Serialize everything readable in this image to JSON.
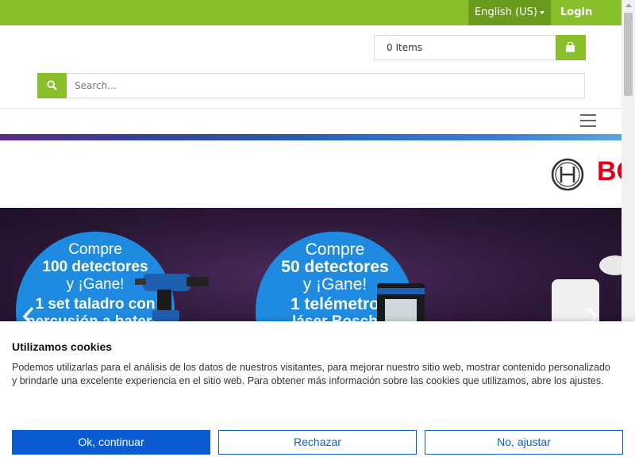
{
  "topbar": {
    "language": "English (US)",
    "login": "Login"
  },
  "cart": {
    "label": "0 Items"
  },
  "search": {
    "placeholder": "Search..."
  },
  "brand": {
    "name": "BOSCH"
  },
  "hero": {
    "promo1": {
      "line1": "Compre",
      "line2": "100 detectores",
      "line3": "y ¡Gane!",
      "line4": "1 set taladro con",
      "line5": "percusión a batería"
    },
    "promo2": {
      "line1": "Compre",
      "line2": "50 detectores",
      "line3": "y ¡Gane!",
      "line4": "1 telémetro",
      "line5": "láser Bosch"
    }
  },
  "cookie": {
    "title": "Utilizamos cookies",
    "text": "Podemos utilizarlas para el análisis de los datos de nuestros visitantes, para mejorar nuestro sitio web, mostrar contenido personalizado y brindarle una excelente experiencia en el sitio web. Para obtener más información sobre las cookies que utilizamos, abre los ajustes.",
    "ok": "Ok, continuar",
    "reject": "Rechazar",
    "adjust": "No, ajustar"
  },
  "colors": {
    "brand_green": "#8abf2c",
    "dark_green": "#6b9b1d",
    "cookie_blue": "#0b5bd3",
    "bosch_red": "#e2001a"
  }
}
